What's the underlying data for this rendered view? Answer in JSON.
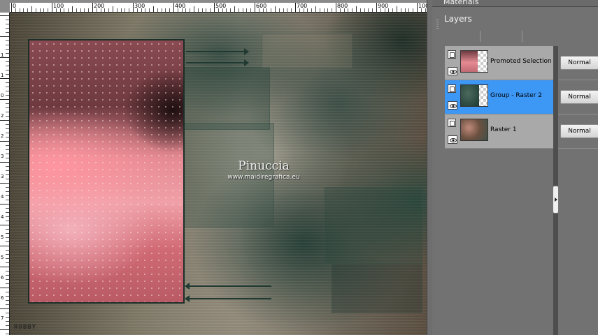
{
  "workspace": {
    "ruler_top_labels": [
      "0",
      "100",
      "200",
      "300",
      "400",
      "500",
      "600",
      "700",
      "800",
      "900",
      "1000"
    ],
    "ruler_left_labels": [
      "1",
      "1",
      "0",
      "2",
      "2",
      "3",
      "3",
      "4",
      "4",
      "5",
      "5",
      "6",
      "6",
      "7",
      "7"
    ],
    "watermark_name": "Pinuccia",
    "watermark_url": "www.maidiregrafica.eu",
    "signature": "ROBBY"
  },
  "panels": {
    "materials_tab": "Materials",
    "layers_title": "Layers"
  },
  "layers": [
    {
      "name": "Promoted Selection",
      "blend_mode": "Normal",
      "active": false,
      "thumb": "promoted-selection"
    },
    {
      "name": "Group - Raster 2",
      "blend_mode": "Normal",
      "active": true,
      "thumb": "group-raster-2"
    },
    {
      "name": "Raster 1",
      "blend_mode": "Normal",
      "active": false,
      "thumb": "raster-1"
    }
  ],
  "colors": {
    "active_layer": "#3d97f5",
    "panel_bg": "#727272",
    "canvas_teal": "#203a32",
    "canvas_pink": "#e58a92"
  }
}
